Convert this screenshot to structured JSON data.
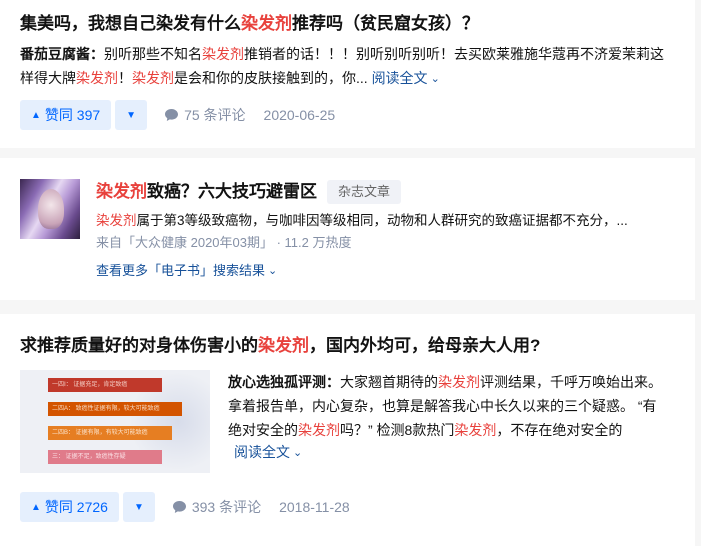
{
  "result1": {
    "title_pre": "集美吗，我想自己染发有什么",
    "title_hl": "染发剂",
    "title_post": "推荐吗（贫民窟女孩）？",
    "author": "番茄豆腐酱：",
    "excerpt_a": "别听那些不知名",
    "excerpt_hl1": "染发剂",
    "excerpt_b": "推销者的话！！！别听别听别听！去买欧莱雅施华蔻再不济爱茉莉这样得大牌",
    "excerpt_hl2": "染发剂",
    "excerpt_c": "！",
    "excerpt_hl3": "染发剂",
    "excerpt_d": "是会和你的皮肤接触到的，你...",
    "read_more": "阅读全文",
    "vote_label": "赞同 397",
    "comments": "75 条评论",
    "date": "2020-06-25"
  },
  "result2": {
    "title_hl": "染发剂",
    "title_post": "致癌？六大技巧避雷区",
    "tag": "杂志文章",
    "excerpt_hl": "染发剂",
    "excerpt": "属于第3等级致癌物，与咖啡因等级相同，动物和人群研究的致癌证据都不充分，...",
    "source": "来自「大众健康 2020年03期」 · 11.2 万热度",
    "more_link": "查看更多「电子书」搜索结果"
  },
  "result3": {
    "title_pre": "求推荐质量好的对身体伤害小的",
    "title_hl": "染发剂",
    "title_post": "，国内外均可，给母亲大人用?",
    "author": "放心选独孤评测：",
    "excerpt_a": "大家翘首期待的",
    "excerpt_hl1": "染发剂",
    "excerpt_b": "评测结果，千呼万唤始出来。拿着报告单，内心复杂，也算是解答我心中长久以来的三个疑惑。 “有绝对安全的",
    "excerpt_hl2": "染发剂",
    "excerpt_c": "吗？” 检测8款热门",
    "excerpt_hl3": "染发剂",
    "excerpt_d": "，不存在绝对安全的",
    "read_more": "阅读全文",
    "thumb_rows": [
      "一四Ⅰ：  证据充足，肯定致癌",
      "二四A：  致癌性证据有限，较大可能致癌",
      "二四B：  证据有限，有较大可能致癌",
      "三：  证据不足，致癌性存疑"
    ],
    "vote_label": "赞同 2726",
    "comments": "393 条评论",
    "date": "2018-11-28"
  },
  "colors": {
    "accent": "#0066ff",
    "highlight": "#e8413c",
    "link": "#175199",
    "meta": "#8590a6"
  },
  "icons": {
    "upvote": "triangle-up-icon",
    "downvote": "triangle-down-icon",
    "comment": "comment-bubble-icon",
    "chevron": "chevron-down-icon"
  }
}
